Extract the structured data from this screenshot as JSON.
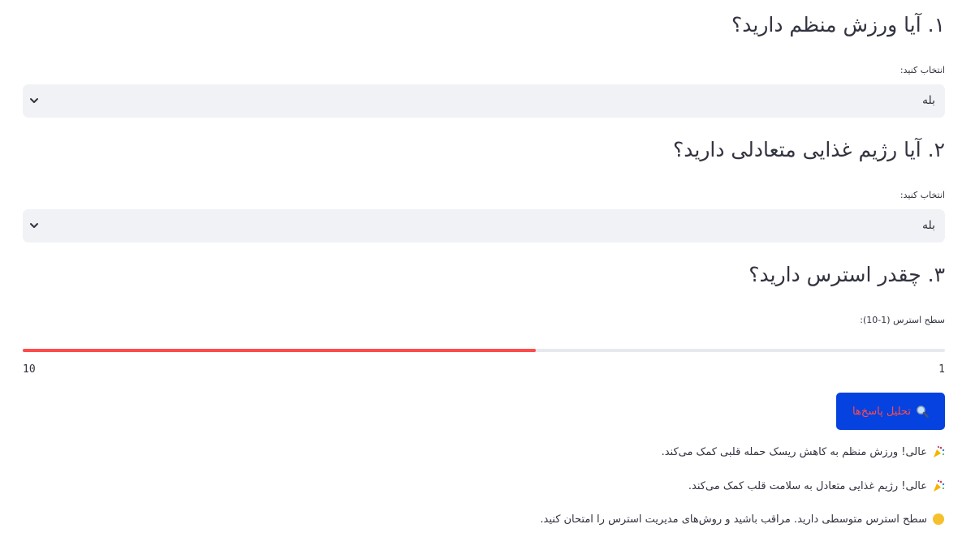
{
  "questions": [
    {
      "heading": "۱. آیا ورزش منظم دارید؟",
      "field_label": "انتخاب کنید:",
      "selected_value": "بله"
    },
    {
      "heading": "۲. آیا رژیم غذایی متعادلی دارید؟",
      "field_label": "انتخاب کنید:",
      "selected_value": "بله"
    },
    {
      "heading": "۳. چقدر استرس دارید؟",
      "field_label": "سطح استرس (1-10):",
      "slider": {
        "min_label": "1",
        "max_label": "10",
        "fill_fraction": 0.556
      }
    }
  ],
  "analyze_button": {
    "label": "تحلیل پاسخ‌ها",
    "icon": "magnifier-icon"
  },
  "results": [
    {
      "icon": "party-popper-icon",
      "text": "عالی! ورزش منظم به کاهش ریسک حمله قلبی کمک می‌کند."
    },
    {
      "icon": "party-popper-icon",
      "text": "عالی! رژیم غذایی متعادل به سلامت قلب کمک می‌کند."
    },
    {
      "icon": "yellow-circle-icon",
      "text": "سطح استرس متوسطی دارید. مراقب باشید و روش‌های مدیریت استرس را امتحان کنید."
    }
  ],
  "colors": {
    "accent": "#ff4b4b",
    "button_bg": "#0642e0",
    "select_bg": "#f0f2f6",
    "text": "#31333f"
  }
}
